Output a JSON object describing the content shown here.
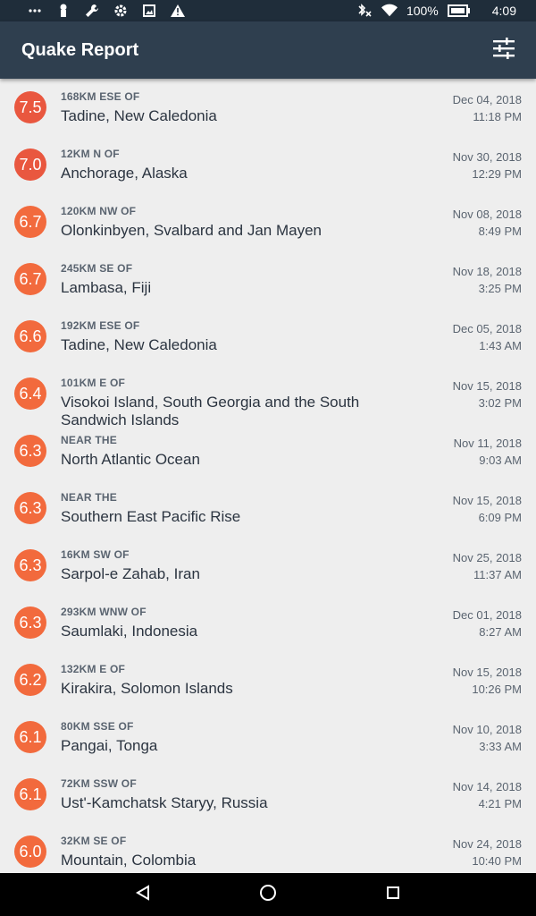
{
  "status": {
    "battery": "100%",
    "time": "4:09",
    "icons": [
      "more-icon",
      "notification-icon",
      "wrench-icon",
      "gear-icon",
      "image-icon",
      "warning-icon",
      "bluetooth-off-icon",
      "wifi-icon",
      "battery-icon"
    ]
  },
  "appbar": {
    "title": "Quake Report",
    "action_icon": "filter-icon"
  },
  "colors": {
    "appbar": "#2f3f4f",
    "statusbar": "#1f2d3a",
    "mag75": "#e9573f",
    "mag70": "#e9573f",
    "mag6x": "#f26a3d",
    "list_bg": "#eeeeee"
  },
  "quakes": [
    {
      "mag": "7.5",
      "offset": "168KM ESE OF",
      "place": "Tadine, New Caledonia",
      "date": "Dec 04, 2018",
      "time": "11:18 PM"
    },
    {
      "mag": "7.0",
      "offset": "12KM N OF",
      "place": "Anchorage, Alaska",
      "date": "Nov 30, 2018",
      "time": "12:29 PM"
    },
    {
      "mag": "6.7",
      "offset": "120KM NW OF",
      "place": "Olonkinbyen, Svalbard and Jan Mayen",
      "date": "Nov 08, 2018",
      "time": "8:49 PM"
    },
    {
      "mag": "6.7",
      "offset": "245KM SE OF",
      "place": "Lambasa, Fiji",
      "date": "Nov 18, 2018",
      "time": "3:25 PM"
    },
    {
      "mag": "6.6",
      "offset": "192KM ESE OF",
      "place": "Tadine, New Caledonia",
      "date": "Dec 05, 2018",
      "time": "1:43 AM"
    },
    {
      "mag": "6.4",
      "offset": "101KM E OF",
      "place": "Visokoi Island, South Georgia and the South Sandwich Islands",
      "date": "Nov 15, 2018",
      "time": "3:02 PM"
    },
    {
      "mag": "6.3",
      "offset": "NEAR THE",
      "place": "North Atlantic Ocean",
      "date": "Nov 11, 2018",
      "time": "9:03 AM"
    },
    {
      "mag": "6.3",
      "offset": "NEAR THE",
      "place": "Southern East Pacific Rise",
      "date": "Nov 15, 2018",
      "time": "6:09 PM"
    },
    {
      "mag": "6.3",
      "offset": "16KM SW OF",
      "place": "Sarpol-e Zahab, Iran",
      "date": "Nov 25, 2018",
      "time": "11:37 AM"
    },
    {
      "mag": "6.3",
      "offset": "293KM WNW OF",
      "place": "Saumlaki, Indonesia",
      "date": "Dec 01, 2018",
      "time": "8:27 AM"
    },
    {
      "mag": "6.2",
      "offset": "132KM E OF",
      "place": "Kirakira, Solomon Islands",
      "date": "Nov 15, 2018",
      "time": "10:26 PM"
    },
    {
      "mag": "6.1",
      "offset": "80KM SSE OF",
      "place": "Pangai, Tonga",
      "date": "Nov 10, 2018",
      "time": "3:33 AM"
    },
    {
      "mag": "6.1",
      "offset": "72KM SSW OF",
      "place": "Ust'-Kamchatsk Staryy, Russia",
      "date": "Nov 14, 2018",
      "time": "4:21 PM"
    },
    {
      "mag": "6.0",
      "offset": "32KM SE OF",
      "place": "Mountain, Colombia",
      "date": "Nov 24, 2018",
      "time": "10:40 PM"
    }
  ],
  "navbar": {
    "icons": [
      "back-icon",
      "home-icon",
      "recents-icon"
    ]
  }
}
